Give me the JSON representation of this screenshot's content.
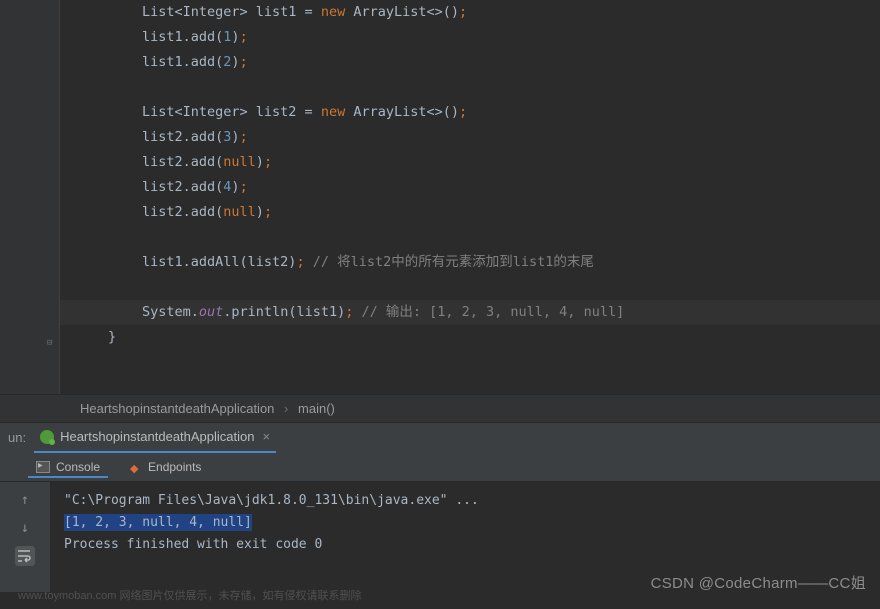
{
  "code": {
    "l1a": "List<Integer> list1 = ",
    "l1b": "new",
    "l1c": " ArrayList<>()",
    "semi": ";",
    "l2a": "list1.add(",
    "l2b": "1",
    "l2c": ")",
    "l3a": "list1.add(",
    "l3b": "2",
    "l3c": ")",
    "l4": "",
    "l5a": "List<Integer> list2 = ",
    "l5b": "new",
    "l5c": " ArrayList<>()",
    "l6a": "list2.add(",
    "l6b": "3",
    "l6c": ")",
    "l7a": "list2.add(",
    "l7b": "null",
    "l7c": ")",
    "l8a": "list2.add(",
    "l8b": "4",
    "l8c": ")",
    "l9a": "list2.add(",
    "l9b": "null",
    "l9c": ")",
    "l10": "",
    "l11a": "list1.addAll(list2)",
    "l11comment": "// 将list2中的所有元素添加到list1的末尾",
    "l12": "",
    "l13a": "System.",
    "l13b": "out",
    "l13c": ".println(list1)",
    "l13comment": "// 输出: [1, 2, 3, null, 4, null]",
    "l14": "}"
  },
  "breadcrumb": {
    "class": "HeartshopinstantdeathApplication",
    "sep": "›",
    "method": "main()"
  },
  "run": {
    "label": "un:",
    "config": "HeartshopinstantdeathApplication",
    "close": "×"
  },
  "consoleTabs": {
    "console": "Console",
    "endpoints": "Endpoints"
  },
  "output": {
    "line1": "\"C:\\Program Files\\Java\\jdk1.8.0_131\\bin\\java.exe\" ...",
    "line2": "[1, 2, 3, null, 4, null]",
    "line3": "",
    "line4": "Process finished with exit code 0"
  },
  "watermark": "CSDN @CodeCharm——CC姐",
  "faintWatermark": "www.toymoban.com 网络图片仅供展示，未存储，如有侵权请联系删除"
}
